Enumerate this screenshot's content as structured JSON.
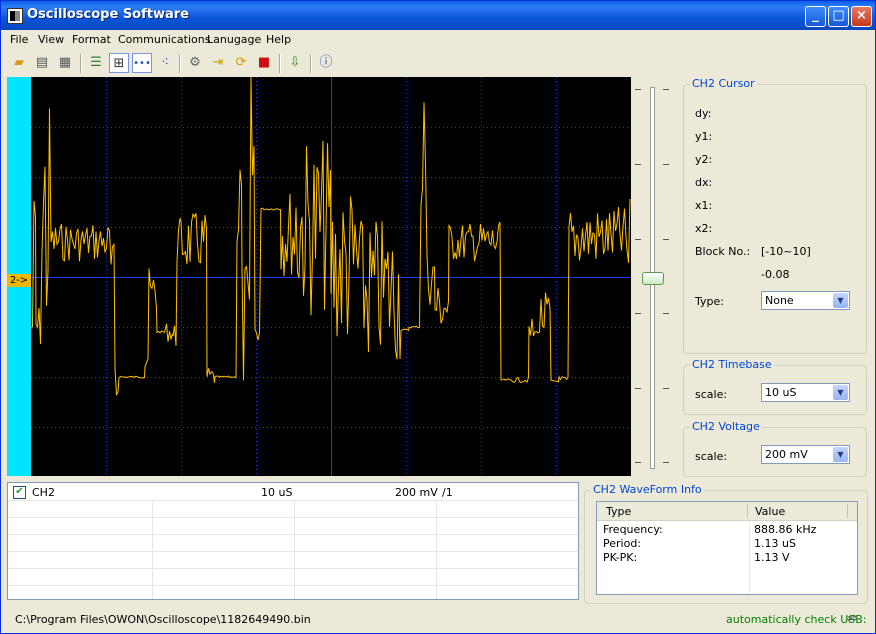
{
  "window": {
    "title": "Oscilloscope Software"
  },
  "menu": [
    "File",
    "View",
    "Format",
    "Communications",
    "Lanugage",
    "Help"
  ],
  "toolbar": {
    "buttons": [
      "open-icon",
      "print-icon",
      "print-preview-icon",
      "list-icon",
      "grid-icon",
      "dots-icon",
      "points-icon",
      "settings-icon",
      "import-icon",
      "refresh-icon",
      "stop-icon",
      "export-icon",
      "help-icon"
    ]
  },
  "scope": {
    "channel_marker": "2->",
    "trace_color": "#ffc000",
    "grid_color": "#1a3aff",
    "background": "#000000",
    "marker_bar_color": "#00e4ff"
  },
  "cursor": {
    "title": "CH2 Cursor",
    "labels": [
      "dy:",
      "y1:",
      "y2:",
      "dx:",
      "x1:",
      "x2:",
      "Block No.:"
    ],
    "block_range": "[-10~10]",
    "block_value": "-0.08",
    "type_label": "Type:",
    "type_value": "None"
  },
  "timebase": {
    "title": "CH2 Timebase",
    "scale_label": "scale:",
    "scale_value": "10 uS"
  },
  "voltage": {
    "title": "CH2 Voltage",
    "scale_label": "scale:",
    "scale_value": "200 mV"
  },
  "channels": [
    {
      "name": "CH2",
      "timebase": "10 uS",
      "voltage": "200 mV",
      "probe": "/1",
      "checked": true
    }
  ],
  "waveinfo": {
    "title": "CH2 WaveForm Info",
    "headers": [
      "Type",
      "Value"
    ],
    "rows": [
      [
        "Frequency:",
        "888.86 kHz"
      ],
      [
        "Period:",
        "1.13 uS"
      ],
      [
        "PK-PK:",
        "1.13 V"
      ]
    ]
  },
  "status": {
    "path": "C:\\Program Files\\OWON\\Oscilloscope\\1182649490.bin",
    "usb": "automatically check USB:"
  }
}
